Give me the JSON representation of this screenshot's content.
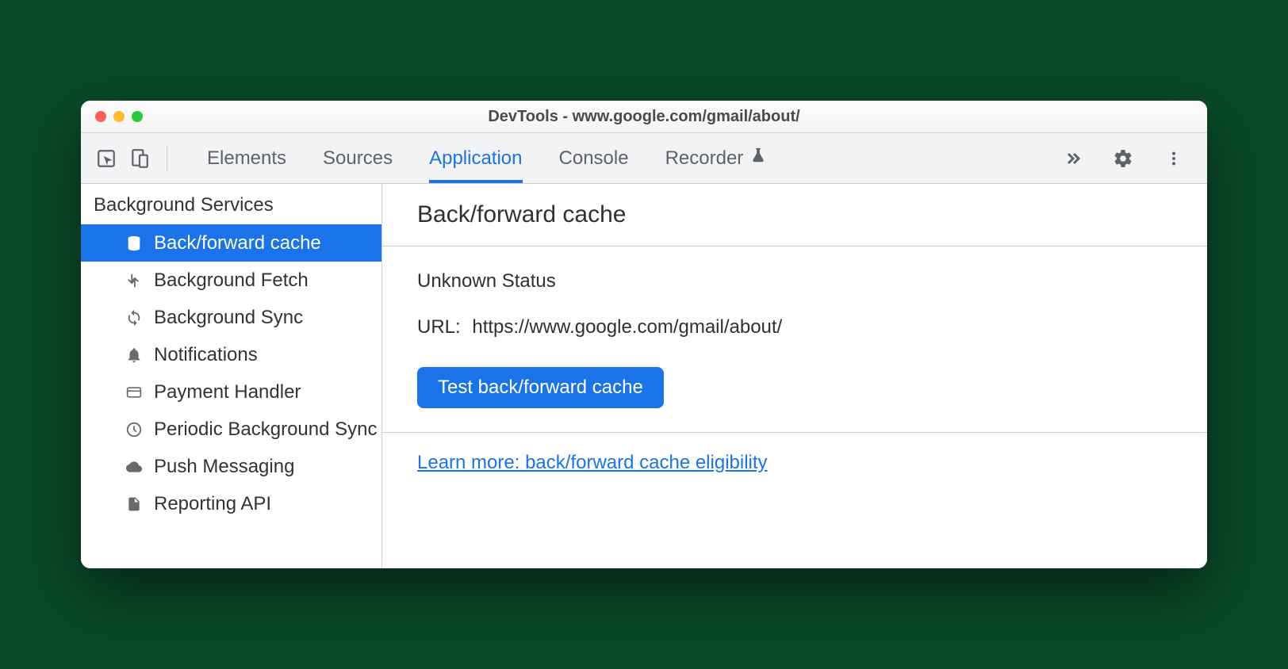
{
  "window": {
    "title": "DevTools - www.google.com/gmail/about/"
  },
  "tabs": {
    "elements": "Elements",
    "sources": "Sources",
    "application": "Application",
    "console": "Console",
    "recorder": "Recorder"
  },
  "sidebar": {
    "heading": "Background Services",
    "items": [
      {
        "label": "Back/forward cache",
        "icon": "database-icon",
        "selected": true
      },
      {
        "label": "Background Fetch",
        "icon": "fetch-icon",
        "selected": false
      },
      {
        "label": "Background Sync",
        "icon": "sync-icon",
        "selected": false
      },
      {
        "label": "Notifications",
        "icon": "bell-icon",
        "selected": false
      },
      {
        "label": "Payment Handler",
        "icon": "card-icon",
        "selected": false
      },
      {
        "label": "Periodic Background Sync",
        "icon": "clock-icon",
        "selected": false
      },
      {
        "label": "Push Messaging",
        "icon": "cloud-icon",
        "selected": false
      },
      {
        "label": "Reporting API",
        "icon": "file-icon",
        "selected": false
      }
    ]
  },
  "main": {
    "title": "Back/forward cache",
    "status": "Unknown Status",
    "url_label": "URL:",
    "url_value": "https://www.google.com/gmail/about/",
    "test_button": "Test back/forward cache",
    "learn_more": "Learn more: back/forward cache eligibility"
  }
}
